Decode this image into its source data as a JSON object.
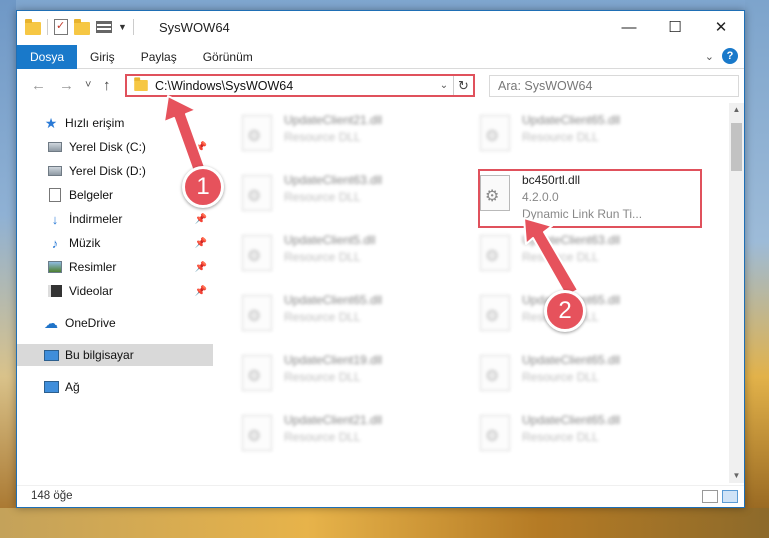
{
  "window": {
    "title": "SysWOW64",
    "controls": {
      "minimize": "—",
      "maximize": "☐",
      "close": "✕"
    }
  },
  "ribbon": {
    "tabs": [
      {
        "label": "Dosya",
        "active": true
      },
      {
        "label": "Giriş"
      },
      {
        "label": "Paylaş"
      },
      {
        "label": "Görünüm"
      }
    ],
    "help": "?"
  },
  "nav": {
    "back": "←",
    "forward": "→",
    "recent": "˅",
    "up": "↑",
    "address": "C:\\Windows\\SysWOW64",
    "refresh": "↻",
    "search_placeholder": "Ara: SysWOW64"
  },
  "sidebar": {
    "items": [
      {
        "label": "Hızlı erişim",
        "icon": "star-icon"
      },
      {
        "label": "Yerel Disk (C:)",
        "icon": "drive-icon",
        "pinned": true
      },
      {
        "label": "Yerel Disk (D:)",
        "icon": "drive-icon",
        "pinned": true
      },
      {
        "label": "Belgeler",
        "icon": "documents-icon",
        "pinned": true
      },
      {
        "label": "İndirmeler",
        "icon": "downloads-icon",
        "pinned": true
      },
      {
        "label": "Müzik",
        "icon": "music-icon",
        "pinned": true
      },
      {
        "label": "Resimler",
        "icon": "pictures-icon",
        "pinned": true
      },
      {
        "label": "Videolar",
        "icon": "videos-icon",
        "pinned": true
      },
      {
        "label": "OneDrive",
        "icon": "cloud-icon"
      },
      {
        "label": "Bu bilgisayar",
        "icon": "computer-icon",
        "selected": true
      },
      {
        "label": "Ağ",
        "icon": "network-icon"
      }
    ]
  },
  "files": {
    "left_column": [
      {
        "name": "UpdateClient21.dll",
        "type": "Resource DLL"
      },
      {
        "name": "UpdateClient63.dll",
        "type": "Resource DLL"
      },
      {
        "name": "UpdateClient5.dll",
        "type": "Resource DLL"
      },
      {
        "name": "UpdateClient65.dll",
        "type": "Resource DLL"
      },
      {
        "name": "UpdateClient19.dll",
        "type": "Resource DLL"
      },
      {
        "name": "UpdateClient21.dll",
        "type": "Resource DLL"
      }
    ],
    "right_column": [
      {
        "name": "UpdateClient65.dll",
        "type": "Resource DLL"
      },
      {
        "name": "UpdateClient63.dll",
        "type": "Resource DLL"
      },
      {
        "name": "UpdateClient65.dll",
        "type": "Resource DLL"
      },
      {
        "name": "UpdateClient65.dll",
        "type": "Resource DLL"
      },
      {
        "name": "UpdateClient65.dll",
        "type": "Resource DLL"
      }
    ],
    "highlighted": {
      "name": "bc450rtl.dll",
      "version": "4.2.0.0",
      "description": "Dynamic Link Run Ti..."
    }
  },
  "status": {
    "count": "148 öğe"
  },
  "annotations": {
    "step1": "1",
    "step2": "2",
    "color": "#e6525c"
  }
}
